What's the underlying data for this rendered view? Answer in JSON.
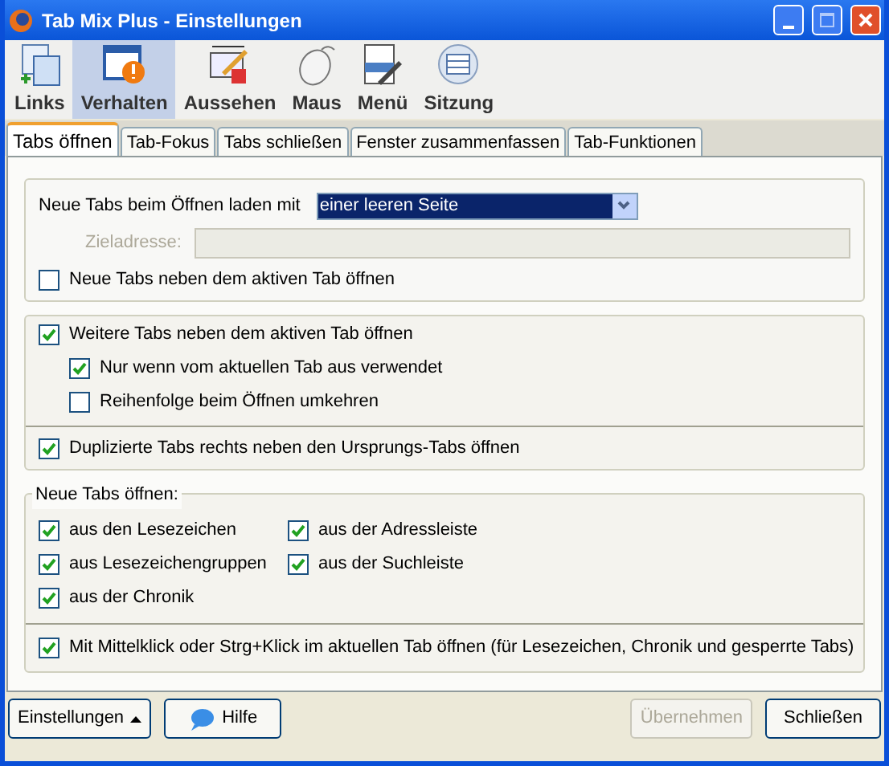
{
  "window": {
    "title": "Tab Mix Plus - Einstellungen"
  },
  "toolbar": [
    {
      "label": "Links",
      "selected": false
    },
    {
      "label": "Verhalten",
      "selected": true
    },
    {
      "label": "Aussehen",
      "selected": false
    },
    {
      "label": "Maus",
      "selected": false
    },
    {
      "label": "Menü",
      "selected": false
    },
    {
      "label": "Sitzung",
      "selected": false
    }
  ],
  "tabs": [
    {
      "label": "Tabs öffnen",
      "selected": true
    },
    {
      "label": "Tab-Fokus",
      "selected": false
    },
    {
      "label": "Tabs schließen",
      "selected": false
    },
    {
      "label": "Fenster zusammenfassen",
      "selected": false
    },
    {
      "label": "Tab-Funktionen",
      "selected": false
    }
  ],
  "load_section": {
    "label": "Neue Tabs beim Öffnen laden mit",
    "dropdown": {
      "value": "einer leeren Seite"
    },
    "target": {
      "label": "Zieladresse:",
      "disabled": true
    },
    "options": [
      {
        "label": "Neue Tabs neben dem aktiven Tab öffnen",
        "checked": false
      }
    ]
  },
  "position_section": {
    "options": [
      {
        "label": "Weitere Tabs neben dem aktiven Tab öffnen",
        "checked": true,
        "children": [
          {
            "label": "Nur wenn vom aktuellen Tab aus verwendet",
            "checked": true
          },
          {
            "label": "Reihenfolge beim Öffnen umkehren",
            "checked": false
          }
        ]
      }
    ],
    "duplicate": {
      "label": "Duplizierte Tabs rechts neben den Ursprungs-Tabs öffnen",
      "checked": true
    }
  },
  "open_section": {
    "title": "Neue Tabs öffnen:",
    "options": [
      {
        "label": "aus den Lesezeichen",
        "checked": true
      },
      {
        "label": "aus der Adressleiste",
        "checked": true
      },
      {
        "label": "aus Lesezeichengruppen",
        "checked": true
      },
      {
        "label": "aus der Suchleiste",
        "checked": true
      },
      {
        "label": "aus der Chronik",
        "checked": true
      }
    ],
    "middle_click": {
      "label": "Mit Mittelklick oder Strg+Klick im aktuellen Tab öffnen (für Lesezeichen, Chronik und gesperrte Tabs)",
      "checked": true
    }
  },
  "buttons": [
    {
      "label": "Einstellungen",
      "kind": "menu",
      "disabled": false
    },
    {
      "label": "Hilfe",
      "kind": "help",
      "disabled": false
    },
    {
      "label": "Übernehmen",
      "kind": "plain",
      "disabled": true
    },
    {
      "label": "Schließen",
      "kind": "plain",
      "disabled": false
    }
  ]
}
